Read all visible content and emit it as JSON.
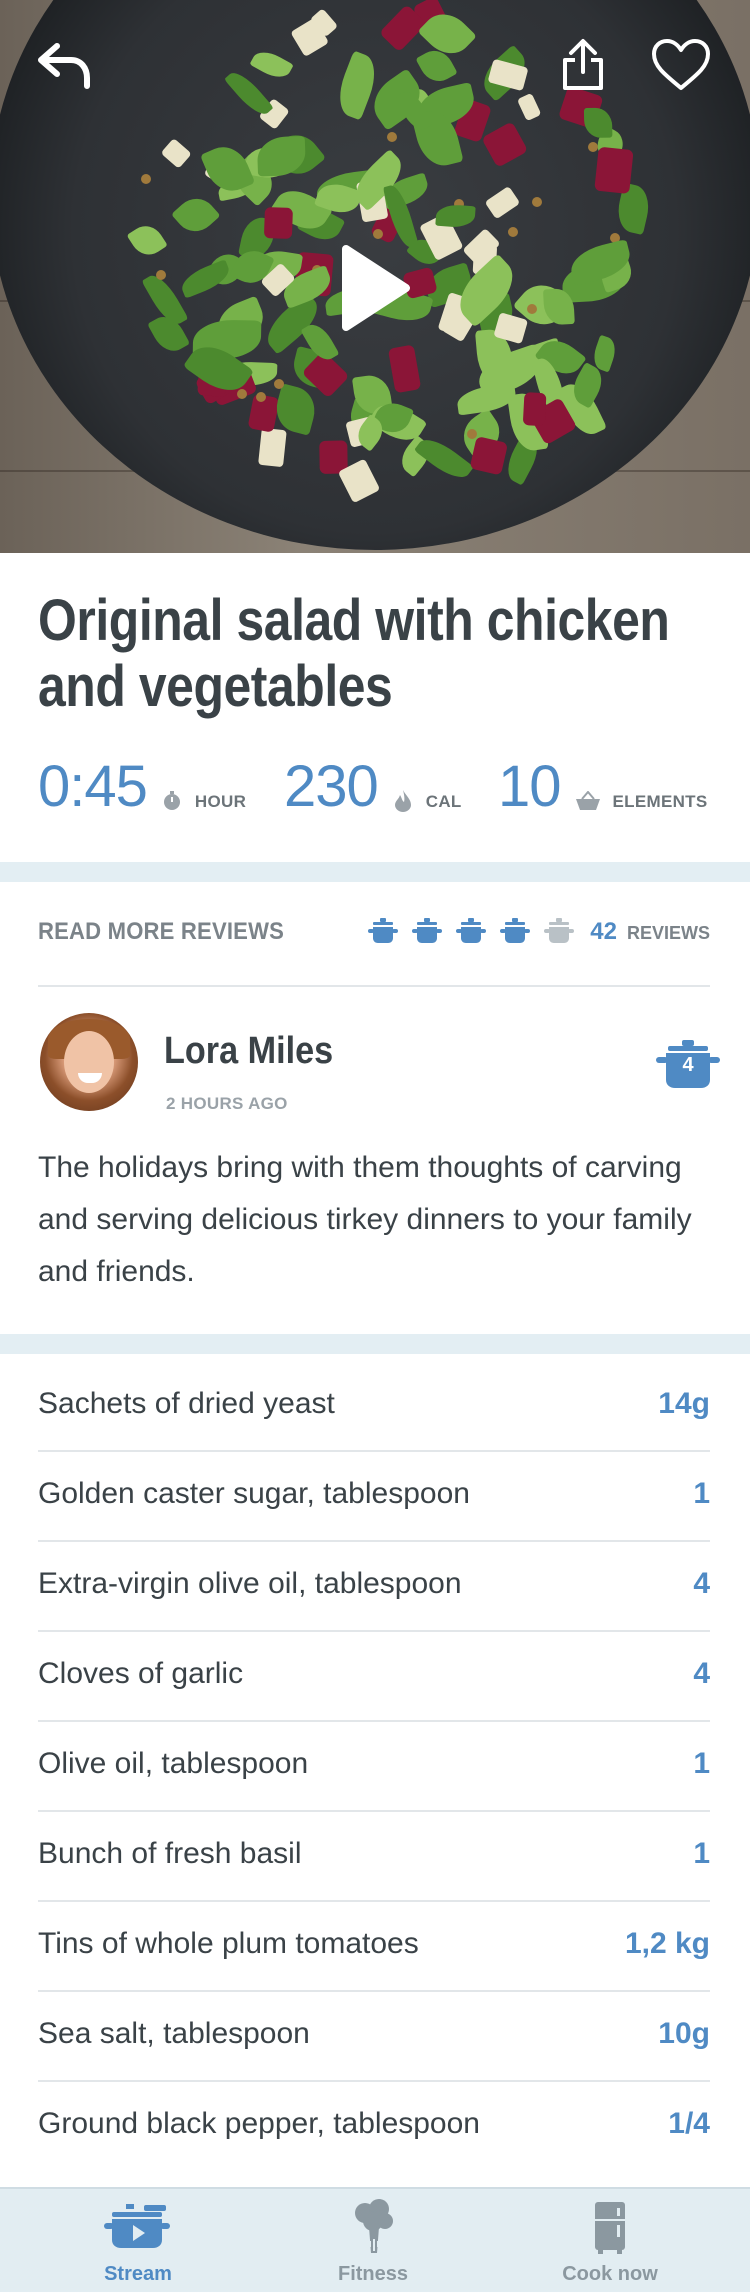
{
  "recipe": {
    "title": "Original salad with chicken and vegetables",
    "stats": {
      "time": {
        "value": "0:45",
        "unit": "HOUR",
        "icon": "timer-icon"
      },
      "calories": {
        "value": "230",
        "unit": "CAL",
        "icon": "flame-icon"
      },
      "elements": {
        "value": "10",
        "unit": "ELEMENTS",
        "icon": "basket-icon"
      }
    }
  },
  "hero": {
    "icons": [
      "back-arrow-icon",
      "share-icon",
      "heart-icon",
      "play-icon"
    ]
  },
  "reviews": {
    "read_more": "READ MORE REVIEWS",
    "rating": 4,
    "rating_max": 5,
    "count": "42",
    "count_label": "REVIEWS",
    "item": {
      "author": "Lora Miles",
      "time": "2 HOURS AGO",
      "rating": "4",
      "text": "The holidays bring with them thoughts of carving and serving delicious tirkey dinners to your family and friends."
    }
  },
  "ingredients": [
    {
      "name": "Sachets of dried yeast",
      "qty": "14g"
    },
    {
      "name": "Golden caster sugar, tablespoon",
      "qty": "1"
    },
    {
      "name": "Extra-virgin olive oil, tablespoon",
      "qty": "4"
    },
    {
      "name": "Cloves of garlic",
      "qty": "4"
    },
    {
      "name": "Olive oil, tablespoon",
      "qty": "1"
    },
    {
      "name": "Bunch of fresh basil",
      "qty": "1"
    },
    {
      "name": "Tins of whole plum tomatoes",
      "qty": "1,2 kg"
    },
    {
      "name": "Sea salt, tablespoon",
      "qty": "10g"
    },
    {
      "name": "Ground black pepper, tablespoon",
      "qty": "1/4"
    }
  ],
  "tabbar": {
    "tabs": [
      {
        "label": "Stream",
        "icon": "pot-tv-icon",
        "active": true
      },
      {
        "label": "Fitness",
        "icon": "broccoli-icon",
        "active": false
      },
      {
        "label": "Cook now",
        "icon": "fridge-icon",
        "active": false
      }
    ]
  },
  "colors": {
    "accent": "#4f8ac4",
    "text": "#3a4247",
    "muted": "#7b8389",
    "band": "#e3eef3",
    "tabbar": "#e2edf2"
  }
}
